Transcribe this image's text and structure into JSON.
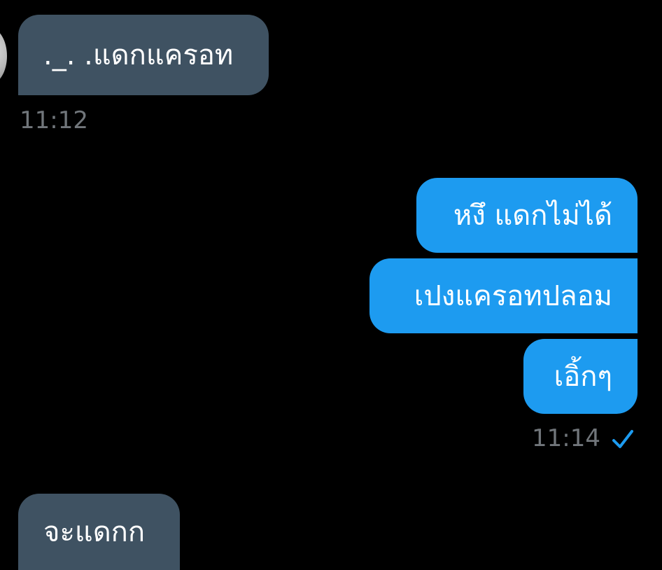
{
  "messages": [
    {
      "direction": "incoming",
      "text": "._. .แดกแครอท"
    },
    {
      "direction": "outgoing",
      "text": "หงึ แดกไม่ได้"
    },
    {
      "direction": "outgoing",
      "text": "เปงแครอทปลอม"
    },
    {
      "direction": "outgoing",
      "text": "เอิ้กๆ"
    },
    {
      "direction": "incoming",
      "text": "จะแดกก"
    }
  ],
  "timestamps": {
    "incoming_group_1": "11:12",
    "outgoing_group_1": "11:14"
  },
  "status": {
    "outgoing_group_1": "sent-checkmark-icon"
  },
  "colors": {
    "background": "#000000",
    "incoming_bubble": "#3f5262",
    "outgoing_bubble": "#1d9bf0",
    "timestamp_text": "#71767b",
    "checkmark": "#1d9bf0"
  }
}
